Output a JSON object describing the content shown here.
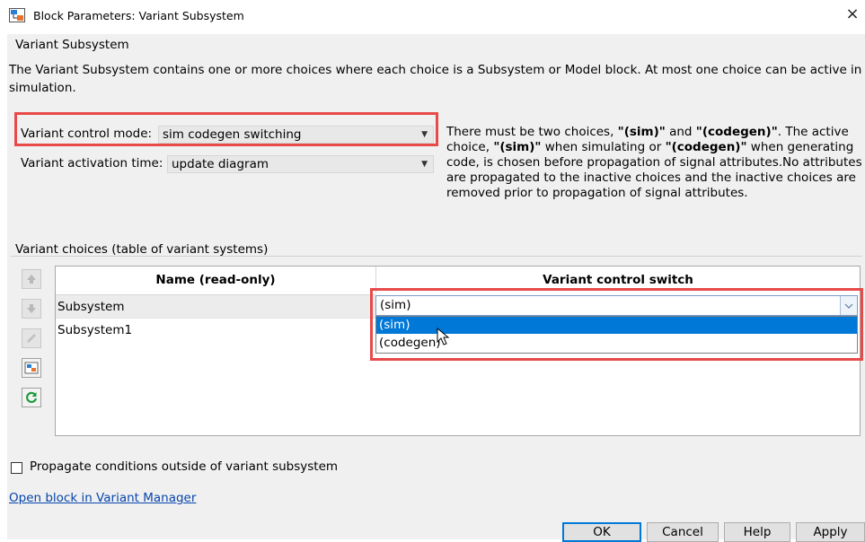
{
  "window": {
    "title": "Block Parameters: Variant Subsystem",
    "close_symbol": "×"
  },
  "group": {
    "title": "Variant Subsystem",
    "description": "The Variant Subsystem contains one or more choices where each choice is a Subsystem or Model block. At most one choice can be active in simulation."
  },
  "variant_control_mode": {
    "label": "Variant control mode:",
    "value": "sim codegen switching"
  },
  "variant_activation_time": {
    "label": "Variant activation time:",
    "value": "update diagram"
  },
  "info": {
    "p1": "There must be two choices, ",
    "sim": "\"(sim)\"",
    "and": " and ",
    "codegen": "\"(codegen)\"",
    "p2": ". The active choice, ",
    "sim2": "\"(sim)\"",
    "p3": " when simulating or ",
    "codegen2": "\"(codegen)\"",
    "p4": " when generating code, is chosen before propagation of signal attributes.No attributes are propagated to the inactive choices and the inactive choices are removed prior to propagation of signal attributes."
  },
  "choices": {
    "title": "Variant choices (table of variant systems)",
    "columns": [
      "Name (read-only)",
      "Variant control switch"
    ],
    "rows": [
      {
        "name": "Subsystem",
        "switch": "(sim)"
      },
      {
        "name": "Subsystem1",
        "switch": ""
      }
    ],
    "dropdown_options": [
      "(sim)",
      "(codegen)"
    ],
    "selected_option": "(sim)"
  },
  "toolbar_icons": [
    "move-up-icon",
    "move-down-icon",
    "edit-icon",
    "add-subsystem-icon",
    "refresh-icon"
  ],
  "propagate_checkbox": {
    "label": "Propagate conditions outside of variant subsystem",
    "checked": false
  },
  "link": "Open block in Variant Manager",
  "buttons": {
    "ok": "OK",
    "cancel": "Cancel",
    "help": "Help",
    "apply": "Apply"
  },
  "colors": {
    "highlight": "#e84a4a",
    "selection": "#0078d7",
    "link": "#0645ad"
  }
}
